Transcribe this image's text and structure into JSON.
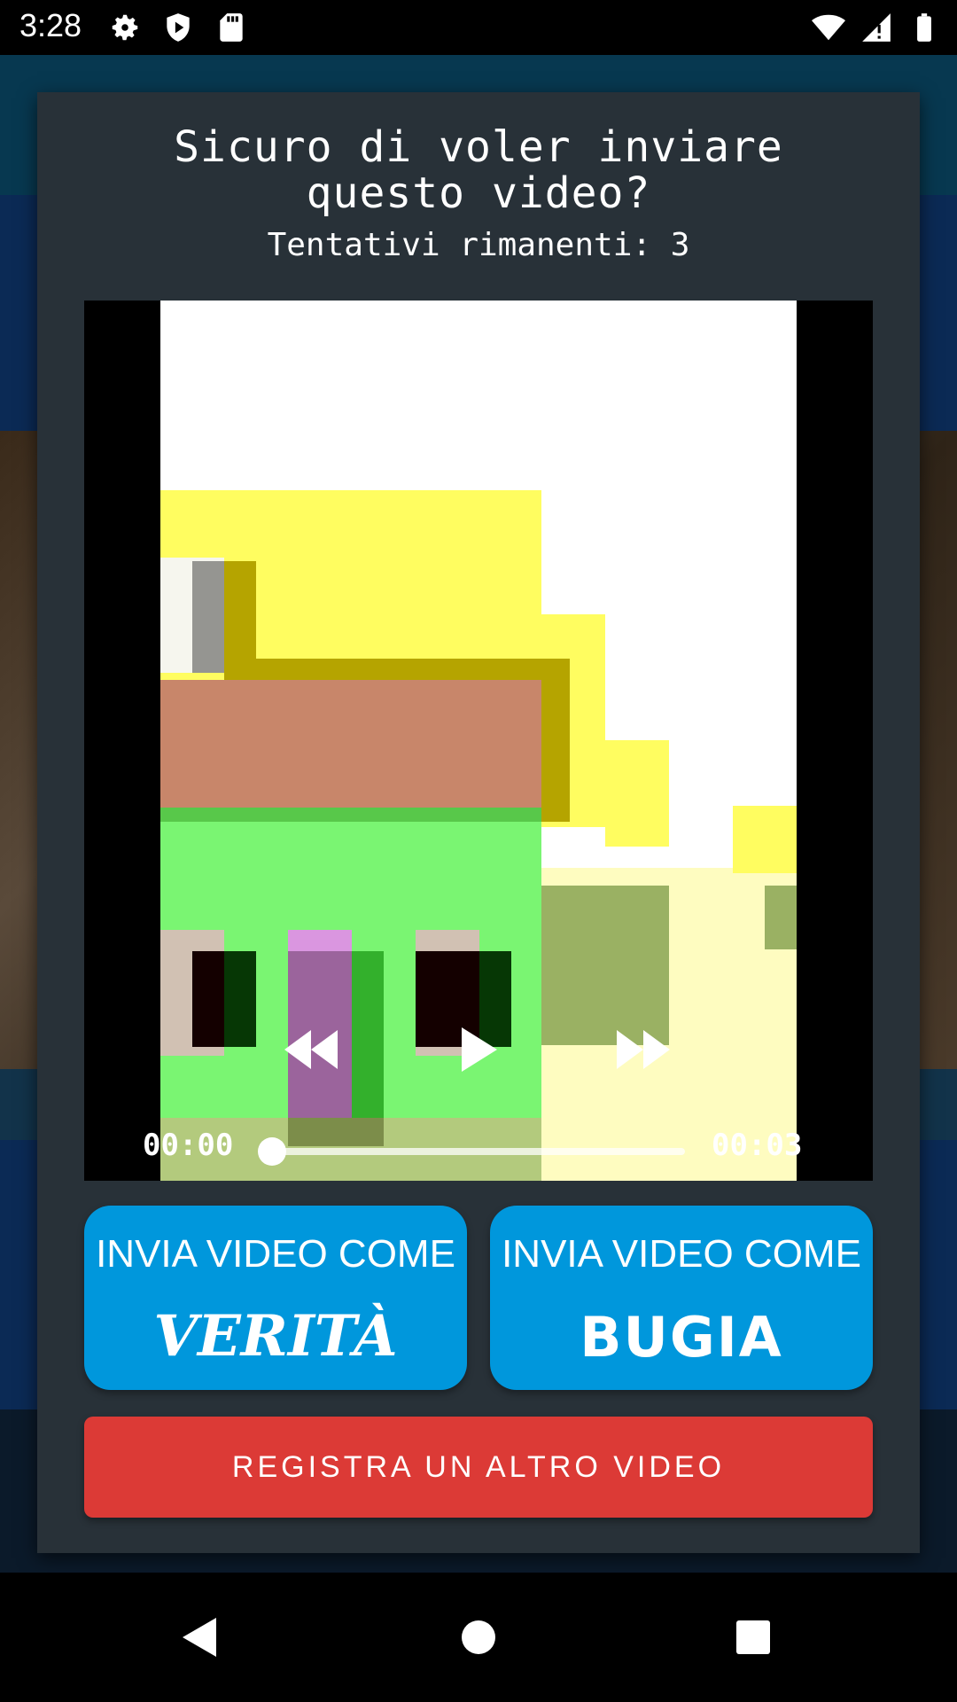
{
  "status_bar": {
    "time": "3:28",
    "left_icons": [
      "gear-icon",
      "shield-play-icon",
      "sd-card-icon"
    ],
    "right_icons": [
      "wifi-icon",
      "signal-icon",
      "battery-icon"
    ]
  },
  "dialog": {
    "title": "Sicuro di voler inviare questo video?",
    "attempts_label": "Tentativi rimanenti: 3"
  },
  "player": {
    "time_current": "00:00",
    "time_total": "00:03",
    "progress": 0,
    "controls": [
      "rewind-icon",
      "play-icon",
      "fast-forward-icon"
    ]
  },
  "buttons": {
    "truth_line1": "INVIA VIDEO COME",
    "truth_line2": "VERITÀ",
    "lie_line1": "INVIA VIDEO COME",
    "lie_line2": "BUGIA",
    "record_again": "REGISTRA UN ALTRO VIDEO"
  },
  "colors": {
    "dialog_bg": "#283138",
    "blue_button": "#0097dc",
    "red_button": "#dc3a36"
  },
  "nav_bar": {
    "icons": [
      "back-icon",
      "home-icon",
      "recents-icon"
    ]
  }
}
